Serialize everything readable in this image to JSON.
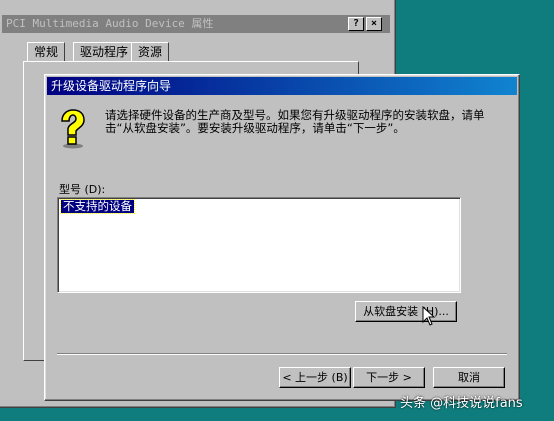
{
  "background_window": {
    "title": "PCI Multimedia Audio Device 属性",
    "help_button": "?",
    "close_button": "×",
    "tabs": [
      {
        "label": "常规"
      },
      {
        "label": "驱动程序"
      },
      {
        "label": "资源"
      }
    ]
  },
  "wizard": {
    "title": "升级设备驱动程序向导",
    "icon": "question-icon",
    "instruction": "请选择硬件设备的生产商及型号。如果您有升级驱动程序的安装软盘，请单击“从软盘安装”。要安装升级驱动程序，请单击“下一步”。",
    "model_label": "型号 (D):",
    "model_items": [
      "不支持的设备"
    ],
    "have_disk_button": "从软盘安装 (H)...",
    "back_button": "< 上一步 (B)",
    "next_button": "下一步 >",
    "cancel_button": "取消"
  },
  "watermark": "头条 @科技说说fans",
  "colors": {
    "desktop": "#0f7d7d",
    "active_title_start": "#000080",
    "active_title_end": "#1084d0",
    "inactive_title": "#808080",
    "face": "#c0c0c0"
  }
}
